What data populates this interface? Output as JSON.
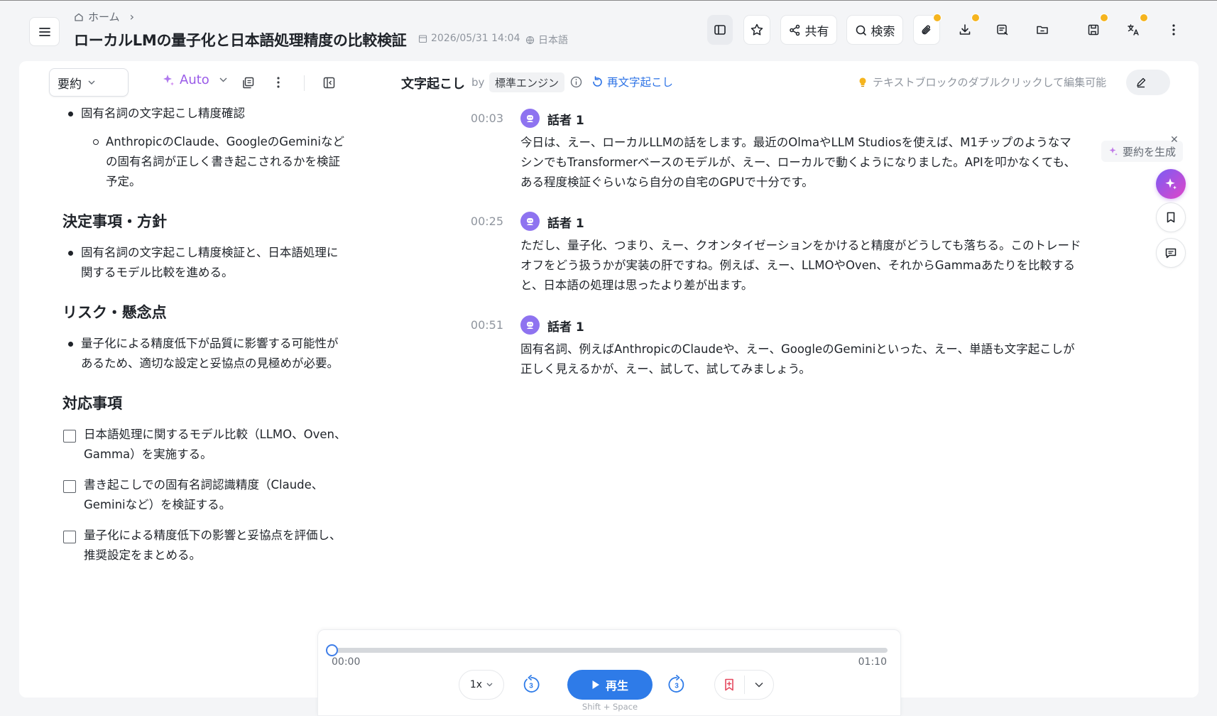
{
  "header": {
    "breadcrumb_home": "ホーム",
    "title": "ローカルLMの量子化と日本語処理精度の比較検証",
    "date": "2026/05/31 14:04",
    "language": "日本語",
    "share_label": "共有",
    "search_label": "検索"
  },
  "summary_panel": {
    "mode_label": "要約",
    "auto_label": "Auto",
    "items": {
      "bullet_1": "固有名詞の文字起こし精度確認",
      "sub_1": "AnthropicのClaude、GoogleのGeminiなどの固有名詞が正しく書き起こされるかを検証予定。",
      "heading_decisions": "決定事項・方針",
      "bullet_2": "固有名詞の文字起こし精度検証と、日本語処理に関するモデル比較を進める。",
      "heading_risks": "リスク・懸念点",
      "bullet_3": "量子化による精度低下が品質に影響する可能性があるため、適切な設定と妥協点の見極めが必要。",
      "heading_actions": "対応事項",
      "action_1": "日本語処理に関するモデル比較（LLMO、Oven、Gamma）を実施する。",
      "action_2": "書き起こしでの固有名詞認識精度（Claude、Geminiなど）を検証する。",
      "action_3": "量子化による精度低下の影響と妥協点を評価し、推奨設定をまとめる。"
    }
  },
  "transcript": {
    "title": "文字起こし",
    "by": "by",
    "engine": "標準エンジン",
    "retranscribe_label": "再文字起こし",
    "edit_hint": "テキストブロックのダブルクリックして編集可能",
    "generate_summary_label": "要約を生成",
    "segments": [
      {
        "time": "00:03",
        "speaker": "話者 1",
        "text": "今日は、えー、ローカルLLMの話をします。最近のOlmaやLLM Studiosを使えば、M1チップのようなマシンでもTransformerベースのモデルが、えー、ローカルで動くようになりました。APIを叩かなくても、ある程度検証ぐらいなら自分の自宅のGPUで十分です。"
      },
      {
        "time": "00:25",
        "speaker": "話者 1",
        "text": "ただし、量子化、つまり、えー、クオンタイゼーションをかけると精度がどうしても落ちる。このトレードオフをどう扱うかが実装の肝ですね。例えば、えー、LLMOやOven、それからGammaあたりを比較すると、日本語の処理は思ったより差が出ます。"
      },
      {
        "time": "00:51",
        "speaker": "話者 1",
        "text": "固有名詞、例えばAnthropicのClaudeや、えー、GoogleのGeminiといった、えー、単語も文字起こしが正しく見えるかが、えー、試して、試してみましょう。"
      }
    ]
  },
  "player": {
    "current_time": "00:00",
    "duration": "01:10",
    "progress": 0,
    "speed": "1x",
    "skip_back_seconds": "3",
    "skip_forward_seconds": "3",
    "play_label": "再生",
    "shortcut": "Shift + Space"
  },
  "colors": {
    "accent_blue": "#2e7be8",
    "ai_purple": "#9a5be8",
    "badge_gold": "#f5b41e",
    "avatar_purple": "#8e73f0"
  }
}
